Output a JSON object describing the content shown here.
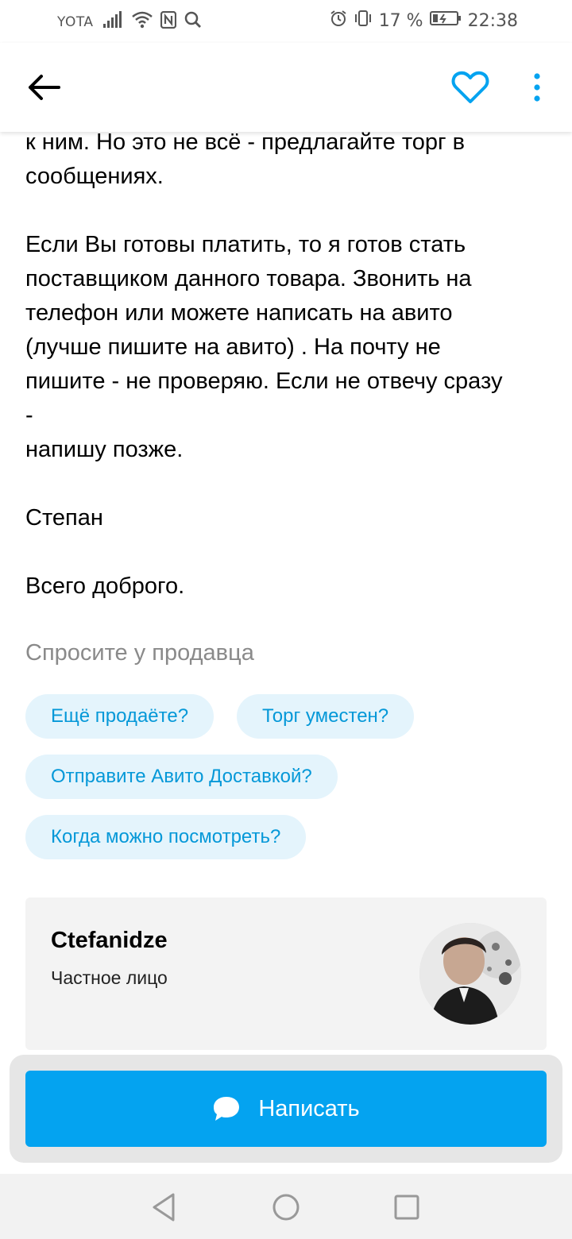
{
  "status_bar": {
    "carrier": "YOTA",
    "battery": "17 %",
    "time": "22:38",
    "icons": [
      "signal-icon",
      "wifi-icon",
      "nfc-icon",
      "search-icon",
      "alarm-icon",
      "vibrate-icon",
      "battery-icon"
    ]
  },
  "app_bar": {
    "icons": [
      "back-arrow-icon",
      "heart-icon",
      "more-vert-icon"
    ],
    "accent": "#04a3f0"
  },
  "description": {
    "lines": [
      "к ним. Но это не всё - предлагайте торг в",
      "сообщениях.",
      "",
      "Если Вы готовы платить, то я готов стать",
      "поставщиком данного товара. Звонить на",
      "телефон или можете написать на авито",
      "(лучше пишите на авито) . На почту не",
      "пишите - не проверяю. Если не отвечу сразу",
      "-",
      "напишу позже.",
      "",
      "Степан",
      "",
      "Всего доброго."
    ]
  },
  "ask_seller": {
    "title": "Спросите у продавца",
    "chips": [
      "Ещё продаёте?",
      "Торг уместен?",
      "Отправите Авито Доставкой?",
      "Когда можно посмотреть?"
    ]
  },
  "seller": {
    "name": "Ctefanidze",
    "type": "Частное лицо"
  },
  "write_button": {
    "label": "Написать",
    "icon": "chat-bubble-icon"
  },
  "nav_bar": {
    "icons": [
      "nav-back-icon",
      "nav-home-icon",
      "nav-recents-icon"
    ]
  }
}
